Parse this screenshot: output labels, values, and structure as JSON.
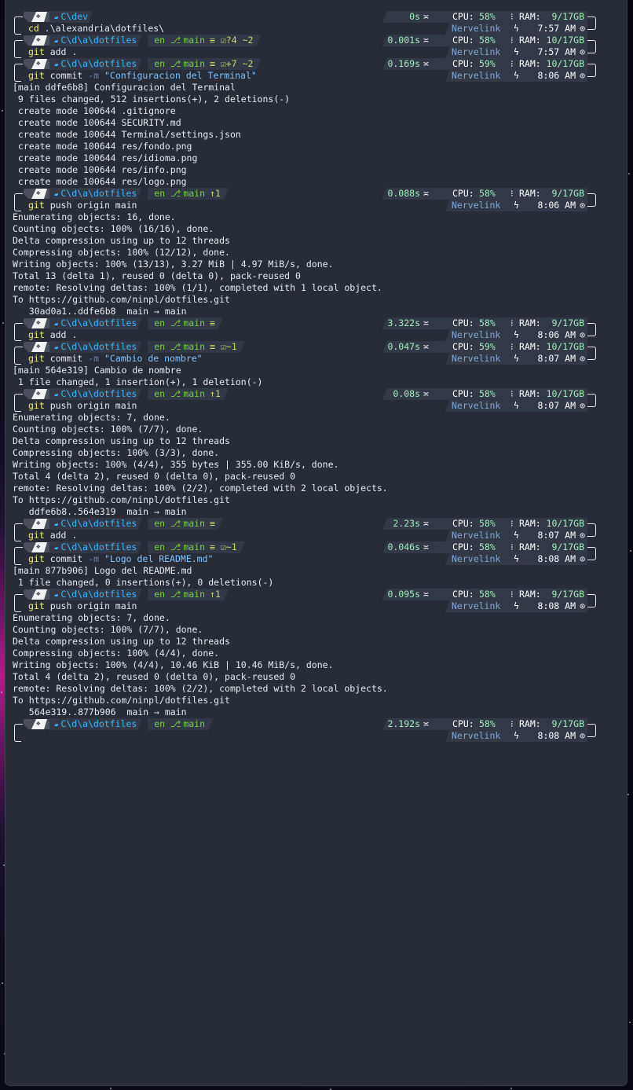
{
  "prompts": [
    {
      "path": "C\\dev",
      "git": null,
      "time": "0s",
      "cpu": "58%",
      "ram": "9/17GB",
      "host": "Nervelink",
      "clock": "7:57 AM",
      "command": {
        "bin": "cd",
        "args": " .\\alexandria\\dotfiles\\"
      }
    },
    {
      "path": "C\\d\\a\\dotfiles",
      "git": {
        "lang": "en",
        "branch": "main",
        "status": "≡ ☑?4 ~2"
      },
      "time": "0.001s",
      "cpu": "58%",
      "ram": "10/17GB",
      "host": "Nervelink",
      "clock": "7:57 AM",
      "command": {
        "bin": "git",
        "args": " add ."
      }
    },
    {
      "path": "C\\d\\a\\dotfiles",
      "git": {
        "lang": "en",
        "branch": "main",
        "status": "≡ ☑+7 ~2"
      },
      "time": "0.169s",
      "cpu": "59%",
      "ram": "10/17GB",
      "host": "Nervelink",
      "clock": "8:06 AM",
      "command": {
        "bin": "git",
        "args": " commit ",
        "flag": "-m",
        "str": "\"Configuracion del Terminal\""
      }
    },
    {
      "path": "C\\d\\a\\dotfiles",
      "git": {
        "lang": "en",
        "branch": "main",
        "status": "↑1"
      },
      "time": "0.088s",
      "cpu": "58%",
      "ram": "9/17GB",
      "host": "Nervelink",
      "clock": "8:06 AM",
      "command": {
        "bin": "git",
        "args": " push origin main"
      }
    },
    {
      "path": "C\\d\\a\\dotfiles",
      "git": {
        "lang": "en",
        "branch": "main",
        "status": "≡"
      },
      "time": "3.322s",
      "cpu": "58%",
      "ram": "9/17GB",
      "host": "Nervelink",
      "clock": "8:06 AM",
      "command": {
        "bin": "git",
        "args": " add ."
      }
    },
    {
      "path": "C\\d\\a\\dotfiles",
      "git": {
        "lang": "en",
        "branch": "main",
        "status": "≡ ☑~1"
      },
      "time": "0.047s",
      "cpu": "59%",
      "ram": "10/17GB",
      "host": "Nervelink",
      "clock": "8:07 AM",
      "command": {
        "bin": "git",
        "args": " commit ",
        "flag": "-m",
        "str": "\"Cambio de nombre\""
      }
    },
    {
      "path": "C\\d\\a\\dotfiles",
      "git": {
        "lang": "en",
        "branch": "main",
        "status": "↑1"
      },
      "time": "0.08s",
      "cpu": "58%",
      "ram": "10/17GB",
      "host": "Nervelink",
      "clock": "8:07 AM",
      "command": {
        "bin": "git",
        "args": " push origin main"
      }
    },
    {
      "path": "C\\d\\a\\dotfiles",
      "git": {
        "lang": "en",
        "branch": "main",
        "status": "≡"
      },
      "time": "2.23s",
      "cpu": "58%",
      "ram": "10/17GB",
      "host": "Nervelink",
      "clock": "8:07 AM",
      "command": {
        "bin": "git",
        "args": " add ."
      }
    },
    {
      "path": "C\\d\\a\\dotfiles",
      "git": {
        "lang": "en",
        "branch": "main",
        "status": "≡ ☑~1"
      },
      "time": "0.046s",
      "cpu": "58%",
      "ram": "9/17GB",
      "host": "Nervelink",
      "clock": "8:08 AM",
      "command": {
        "bin": "git",
        "args": " commit ",
        "flag": "-m",
        "str": "\"Logo del README.md\""
      }
    },
    {
      "path": "C\\d\\a\\dotfiles",
      "git": {
        "lang": "en",
        "branch": "main",
        "status": "↑1"
      },
      "time": "0.095s",
      "cpu": "58%",
      "ram": "9/17GB",
      "host": "Nervelink",
      "clock": "8:08 AM",
      "command": {
        "bin": "git",
        "args": " push origin main"
      }
    },
    {
      "path": "C\\d\\a\\dotfiles",
      "git": {
        "lang": "en",
        "branch": "main",
        "status": ""
      },
      "time": "2.192s",
      "cpu": "58%",
      "ram": "9/17GB",
      "host": "Nervelink",
      "clock": "8:08 AM",
      "command": null
    }
  ],
  "outputs": {
    "2": [
      "[main ddfe6b8] Configuracion del Terminal",
      " 9 files changed, 512 insertions(+), 2 deletions(-)",
      " create mode 100644 .gitignore",
      " create mode 100644 SECURITY.md",
      " create mode 100644 Terminal/settings.json",
      " create mode 100644 res/fondo.png",
      " create mode 100644 res/idioma.png",
      " create mode 100644 res/info.png",
      " create mode 100644 res/logo.png"
    ],
    "3": [
      "Enumerating objects: 16, done.",
      "Counting objects: 100% (16/16), done.",
      "Delta compression using up to 12 threads",
      "Compressing objects: 100% (12/12), done.",
      "Writing objects: 100% (13/13), 3.27 MiB | 4.97 MiB/s, done.",
      "Total 13 (delta 1), reused 0 (delta 0), pack-reused 0",
      "remote: Resolving deltas: 100% (1/1), completed with 1 local object.",
      "To https://github.com/ninpl/dotfiles.git",
      "   30ad0a1..ddfe6b8  main → main"
    ],
    "5": [
      "[main 564e319] Cambio de nombre",
      " 1 file changed, 1 insertion(+), 1 deletion(-)"
    ],
    "6": [
      "Enumerating objects: 7, done.",
      "Counting objects: 100% (7/7), done.",
      "Delta compression using up to 12 threads",
      "Compressing objects: 100% (3/3), done.",
      "Writing objects: 100% (4/4), 355 bytes | 355.00 KiB/s, done.",
      "Total 4 (delta 2), reused 0 (delta 0), pack-reused 0",
      "remote: Resolving deltas: 100% (2/2), completed with 2 local objects.",
      "To https://github.com/ninpl/dotfiles.git",
      "   ddfe6b8..564e319  main → main"
    ],
    "8": [
      "[main 877b906] Logo del README.md",
      " 1 file changed, 0 insertions(+), 0 deletions(-)"
    ],
    "9": [
      "Enumerating objects: 7, done.",
      "Counting objects: 100% (7/7), done.",
      "Delta compression using up to 12 threads",
      "Compressing objects: 100% (4/4), done.",
      "Writing objects: 100% (4/4), 10.46 KiB | 10.46 MiB/s, done.",
      "Total 4 (delta 2), reused 0 (delta 0), pack-reused 0",
      "remote: Resolving deltas: 100% (2/2), completed with 2 local objects.",
      "To https://github.com/ninpl/dotfiles.git",
      "   564e319..877b906  main → main"
    ]
  },
  "labels": {
    "cpu": "CPU:",
    "ram": "RAM:",
    "os_glyph": "❖",
    "folder_glyph": "▰",
    "branch_glyph": "⎇",
    "clock_glyph": "⊙",
    "bolt_glyph": "ϟ",
    "bars_glyph": "⁝",
    "dur_glyph": "≍"
  }
}
